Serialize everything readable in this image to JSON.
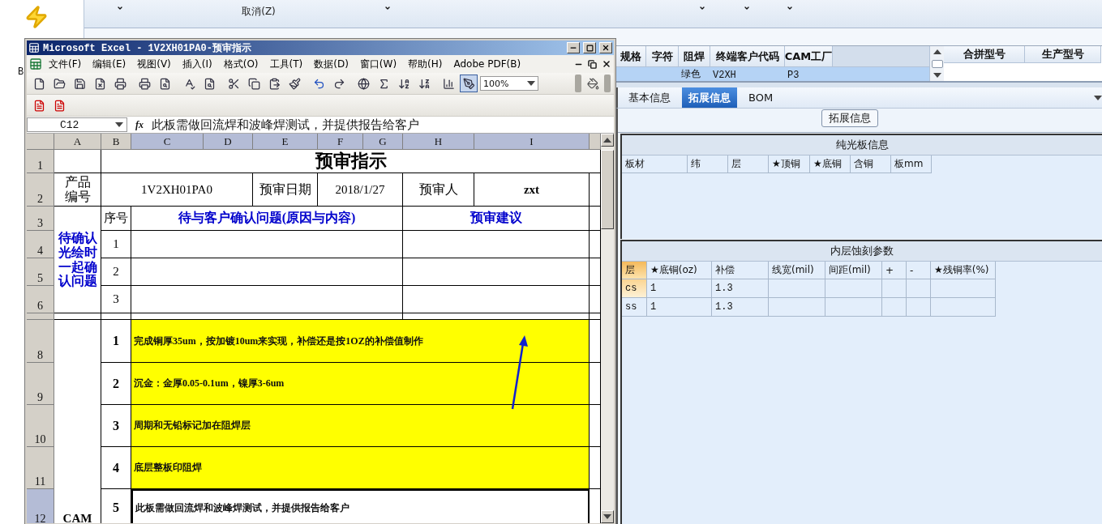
{
  "sidebar": {
    "label": "B"
  },
  "ribbon": {
    "cancel": "取消(Z)"
  },
  "order_grid": {
    "columns": [
      "规格",
      "字符",
      "阻焊",
      "终端客户代码",
      "CAM工厂"
    ],
    "rows": [
      {
        "values": [
          "绿色",
          "V2XH",
          "P3"
        ],
        "selected": true
      }
    ]
  },
  "merge_grid": {
    "columns": [
      "合拼型号",
      "生产型号"
    ]
  },
  "tabs": [
    {
      "label": "基本信息",
      "selected": false
    },
    {
      "label": "拓展信息",
      "selected": true
    },
    {
      "label": "BOM",
      "selected": false
    }
  ],
  "group_label": "拓展信息",
  "bare_board": {
    "title": "纯光板信息",
    "columns": [
      "板材",
      "纬",
      "层",
      "★顶铜",
      "★底铜",
      "含铜",
      "板mm"
    ]
  },
  "inner_etch": {
    "title": "内层蚀刻参数",
    "columns": [
      "层",
      "★底铜(oz)",
      "补偿",
      "线宽(mil)",
      "间距(mil)",
      "+",
      "-",
      "★残铜率(%)"
    ],
    "rows": [
      {
        "cells": [
          "cs",
          "1",
          "1.3"
        ],
        "selected": true
      },
      {
        "cells": [
          "ss",
          "1",
          "1.3"
        ],
        "selected": false
      }
    ]
  },
  "excel": {
    "title": "Microsoft Excel - 1V2XH01PA0-预审指示",
    "menu": [
      "文件(F)",
      "编辑(E)",
      "视图(V)",
      "插入(I)",
      "格式(O)",
      "工具(T)",
      "数据(D)",
      "窗口(W)",
      "帮助(H)",
      "Adobe PDF(B)"
    ],
    "zoom": "100%",
    "name_box": "C12",
    "fx": "fx",
    "formula": "此板需做回流焊和波峰焊测试，并提供报告给客户",
    "columns": [
      {
        "label": "A",
        "selected": false
      },
      {
        "label": "B",
        "selected": false
      },
      {
        "label": "C",
        "selected": true
      },
      {
        "label": "D",
        "selected": true
      },
      {
        "label": "E",
        "selected": true
      },
      {
        "label": "F",
        "selected": true
      },
      {
        "label": "G",
        "selected": true
      },
      {
        "label": "H",
        "selected": true
      },
      {
        "label": "I",
        "selected": true
      }
    ],
    "rows": [
      {
        "label": "1",
        "selected": false
      },
      {
        "label": "2",
        "selected": false
      },
      {
        "label": "3",
        "selected": false
      },
      {
        "label": "4",
        "selected": false
      },
      {
        "label": "5",
        "selected": false
      },
      {
        "label": "6",
        "selected": false
      },
      {
        "selected": false
      },
      {
        "label": "8",
        "selected": false
      },
      {
        "label": "9",
        "selected": false
      },
      {
        "label": "10",
        "selected": false
      },
      {
        "label": "11",
        "selected": false
      },
      {
        "label": "12",
        "selected": true
      }
    ],
    "sheet": {
      "title": "预审指示",
      "product_label": "产品编号",
      "product_no": "1V2XH01PA0",
      "date_label": "预审日期",
      "date": "2018/1/27",
      "reviewer_label": "预审人",
      "reviewer": "zxt",
      "pending": {
        "label": "待确认光绘时一起确认问题",
        "no_header": "序号",
        "question_header": "待与客户确认问题(原因与内容)",
        "advice_header": "预审建议",
        "numbers": [
          "1",
          "2",
          "3"
        ]
      },
      "cam": {
        "label": "CAM",
        "items": [
          {
            "no": "1",
            "text": "完成铜厚35um，按加镀10um来实现，补偿还是按1OZ的补偿值制作",
            "highlighted": true
          },
          {
            "no": "2",
            "text": "沉金：金厚0.05-0.1um，镍厚3-6um",
            "highlighted": true
          },
          {
            "no": "3",
            "text": "周期和无铅标记加在阻焊层",
            "highlighted": true
          },
          {
            "no": "4",
            "text": "底层整板印阻焊",
            "highlighted": true
          },
          {
            "no": "5",
            "text": "此板需做回流焊和波峰焊测试，并提供报告给客户",
            "highlighted": false
          }
        ]
      }
    }
  }
}
